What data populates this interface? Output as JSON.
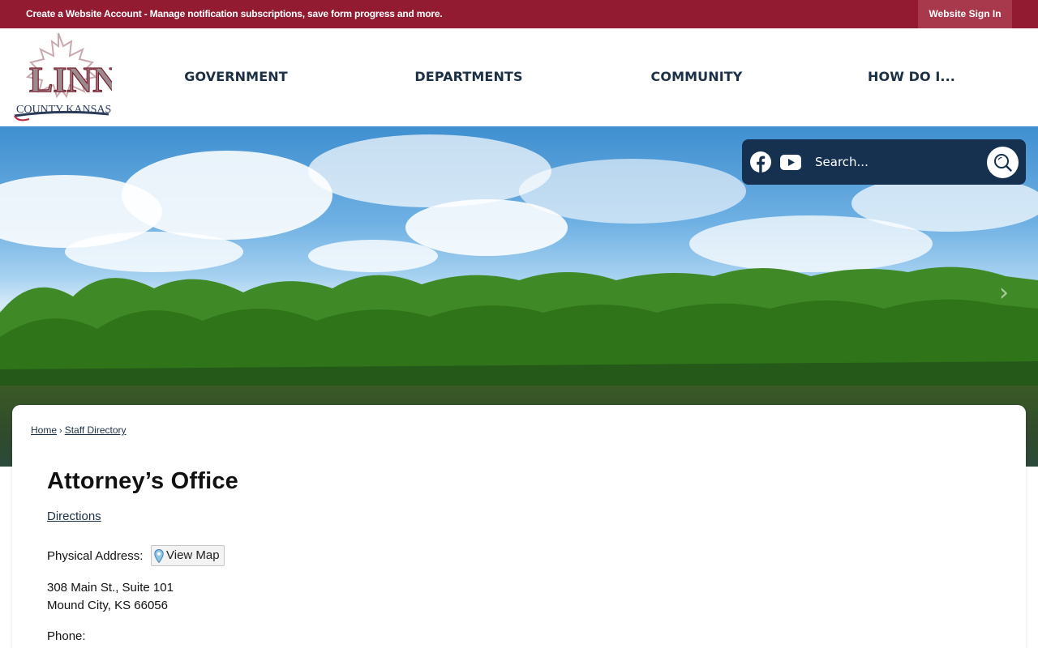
{
  "topbar": {
    "text": "Create a Website Account - Manage notification subscriptions, save form progress and more.",
    "signin_label": "Website Sign In"
  },
  "logo": {
    "line1": "LINN",
    "line2": "COUNTY KANSAS"
  },
  "nav": {
    "items": [
      {
        "label": "GOVERNMENT"
      },
      {
        "label": "DEPARTMENTS"
      },
      {
        "label": "COMMUNITY"
      },
      {
        "label": "HOW DO I..."
      }
    ]
  },
  "search": {
    "placeholder": "Search...",
    "social": [
      "facebook-icon",
      "youtube-icon"
    ]
  },
  "breadcrumb": {
    "home": "Home",
    "sep": "›",
    "current": "Staff Directory"
  },
  "content": {
    "title": "Attorney’s Office",
    "directions_label": "Directions",
    "physical_address_label": "Physical Address:",
    "view_map_label": "View Map",
    "address_line1": "308 Main St., Suite 101",
    "address_line2": "Mound City, KS 66056",
    "phone_label": "Phone:"
  },
  "colors": {
    "topbar": "#931b31",
    "nav_text": "#1b2f45",
    "search_bg": "#16304f"
  }
}
